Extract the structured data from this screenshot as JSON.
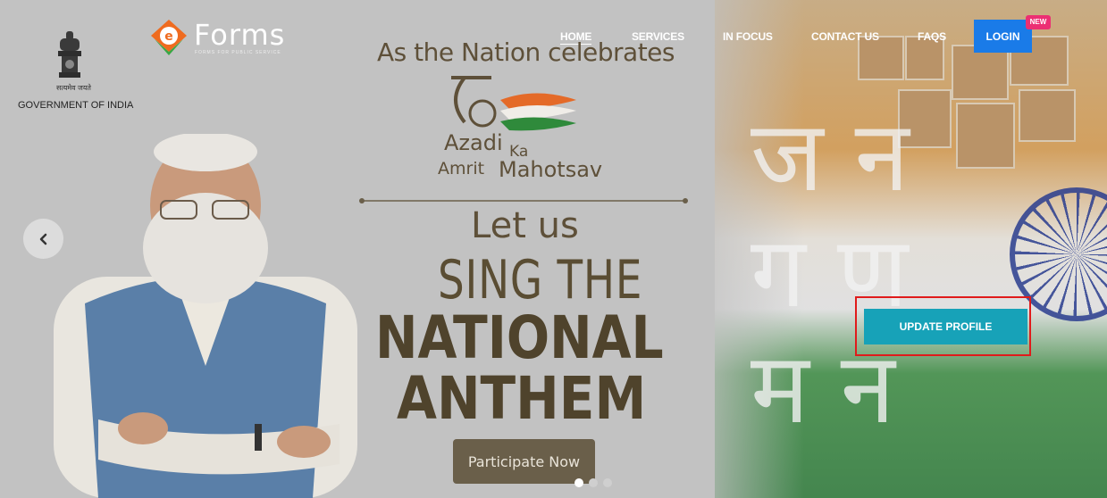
{
  "header": {
    "gov_label": "GOVERNMENT OF INDIA",
    "gov_motto": "सत्यमेव जयते",
    "logo_text": "Forms",
    "logo_tagline": "FORMS FOR PUBLIC SERVICE"
  },
  "nav": {
    "items": [
      {
        "label": "HOME"
      },
      {
        "label": "SERVICES"
      },
      {
        "label": "IN FOCUS"
      },
      {
        "label": "CONTACT US"
      },
      {
        "label": "FAQS"
      }
    ],
    "login_label": "LOGIN",
    "new_badge": "NEW"
  },
  "banner": {
    "celebrates": "As the Nation celebrates",
    "azadi": "Azadi",
    "ka": "Ka",
    "amrit": "Amrit",
    "mahotsav": "Mahotsav",
    "let_us": "Let us",
    "sing_the": "SING THE",
    "national": "NATIONAL",
    "anthem": "ANTHEM",
    "participate_label": "Participate Now",
    "collage_text": "ज न ग ण म न"
  },
  "actions": {
    "update_profile_label": "UPDATE PROFILE"
  },
  "carousel": {
    "slide_count": 3,
    "active_index": 0
  },
  "colors": {
    "login_bg": "#1a7be8",
    "new_badge_bg": "#ec2f73",
    "update_profile_bg": "#17a2b8",
    "highlight_border": "#e01b1b",
    "banner_text": "#5e5039"
  }
}
